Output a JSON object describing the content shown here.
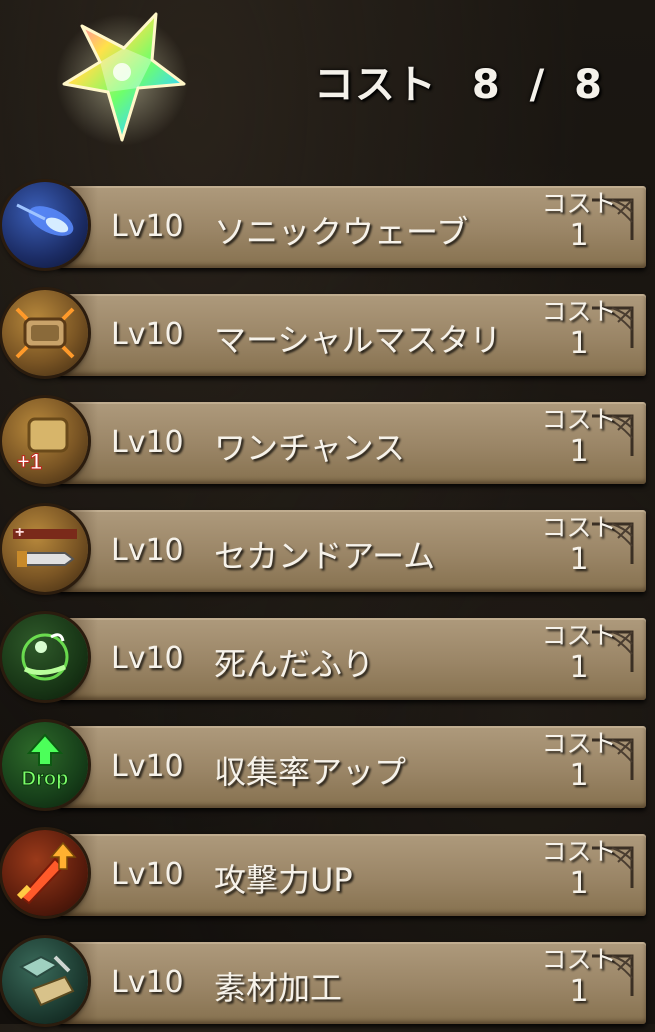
{
  "header": {
    "cost_label": "コスト",
    "cost_used": "8",
    "cost_separator": "/",
    "cost_max": "8",
    "emblem_icon": "rainbow-star-icon"
  },
  "skills": [
    {
      "level": "Lv10",
      "name": "ソニックウェーブ",
      "cost_label": "コスト",
      "cost": "1",
      "icon": "sonic-wave-icon"
    },
    {
      "level": "Lv10",
      "name": "マーシャルマスタリ",
      "cost_label": "コスト",
      "cost": "1",
      "icon": "martial-mastery-icon"
    },
    {
      "level": "Lv10",
      "name": "ワンチャンス",
      "cost_label": "コスト",
      "cost": "1",
      "icon": "one-chance-icon"
    },
    {
      "level": "Lv10",
      "name": "セカンドアーム",
      "cost_label": "コスト",
      "cost": "1",
      "icon": "second-arm-icon"
    },
    {
      "level": "Lv10",
      "name": "死んだふり",
      "cost_label": "コスト",
      "cost": "1",
      "icon": "play-dead-icon"
    },
    {
      "level": "Lv10",
      "name": "収集率アップ",
      "cost_label": "コスト",
      "cost": "1",
      "icon": "drop-up-icon"
    },
    {
      "level": "Lv10",
      "name": "攻撃力UP",
      "cost_label": "コスト",
      "cost": "1",
      "icon": "attack-up-icon"
    },
    {
      "level": "Lv10",
      "name": "素材加工",
      "cost_label": "コスト",
      "cost": "1",
      "icon": "material-processing-icon"
    }
  ],
  "icon_badges": {
    "one_chance": "+1",
    "drop": "Drop"
  },
  "colors": {
    "bar": "#9a8566",
    "text": "#f6f2ea",
    "background": "#16120f"
  }
}
